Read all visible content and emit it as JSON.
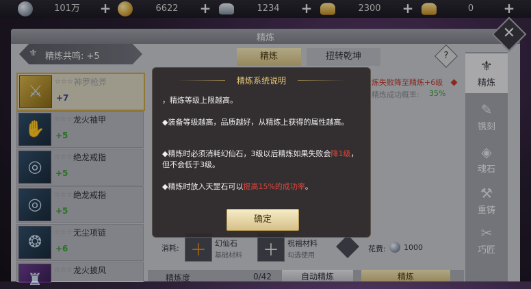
{
  "resources": [
    {
      "icon": "silver-coin-icon",
      "value": "101万",
      "add": "+"
    },
    {
      "icon": "gold-coin-icon",
      "value": "6622",
      "add": "+"
    },
    {
      "icon": "silver-ingot-icon",
      "value": "1234",
      "add": "+"
    },
    {
      "icon": "gold-ingot-icon",
      "value": "2300",
      "add": "+"
    },
    {
      "icon": "gold-ingot-icon",
      "value": "0",
      "add": "+"
    }
  ],
  "panel": {
    "title": "精炼",
    "close": "✕",
    "resonance": "精炼共鸣: +5",
    "tabs": [
      "精炼",
      "扭转乾坤"
    ],
    "help": "?"
  },
  "items": [
    {
      "name": "神罗枪斧",
      "stars": "☆☆☆",
      "level": "+7",
      "icon": "axe-icon",
      "glyph": "⚔"
    },
    {
      "name": "龙火袖甲",
      "stars": "☆☆☆",
      "level": "+5",
      "icon": "gauntlet-icon",
      "glyph": "✋"
    },
    {
      "name": "绝龙戒指",
      "stars": "☆☆☆",
      "level": "+5",
      "icon": "ring-icon",
      "glyph": "◎"
    },
    {
      "name": "绝龙戒指",
      "stars": "☆☆☆",
      "level": "+5",
      "icon": "ring-icon",
      "glyph": "◎"
    },
    {
      "name": "无尘项链",
      "stars": "☆☆☆",
      "level": "+6",
      "icon": "necklace-icon",
      "glyph": "❂"
    },
    {
      "name": "龙火披风",
      "stars": "☆☆☆",
      "level": "",
      "icon": "cloak-icon",
      "glyph": "♜"
    }
  ],
  "nav": [
    {
      "label": "精炼",
      "icon": "refine-icon",
      "glyph": "⚜"
    },
    {
      "label": "镌刻",
      "icon": "engrave-icon",
      "glyph": "✎"
    },
    {
      "label": "魂石",
      "icon": "soulstone-icon",
      "glyph": "◈"
    },
    {
      "label": "重铸",
      "icon": "reforge-icon",
      "glyph": "⚒"
    },
    {
      "label": "巧匠",
      "icon": "artisan-icon",
      "glyph": "✂"
    }
  ],
  "background": {
    "fail_note": "炼失败降至精炼+6级",
    "rate_label": "精炼成功概率:",
    "rate_value": "35%"
  },
  "bottom": {
    "consume_label": "消耗:",
    "material1_name": "幻仙石",
    "material1_sub": "基础材料",
    "material2_name": "祝福材料",
    "material2_sub": "勾选使用",
    "cost_label": "花费:",
    "cost_value": "1000",
    "degree_label": "精炼度",
    "degree_value": "0/42",
    "auto_button": "自动精炼",
    "refine_button": "精炼"
  },
  "modal": {
    "title": "精炼系统说明",
    "rule1": "，精炼等级上限越高。",
    "rule2": "◆装备等级越高，品质越好，从精炼上获得的属性越高。",
    "rule3_a": "◆精炼时必须消耗幻仙石，3级以后精炼如果失败会",
    "rule3_hl": "降1级",
    "rule3_b": "，但不会低于3级。",
    "rule4_a": "◆精炼时放入天罡石可以",
    "rule4_hl": "提高15%的成功率",
    "rule4_b": "。",
    "ok": "确定"
  }
}
